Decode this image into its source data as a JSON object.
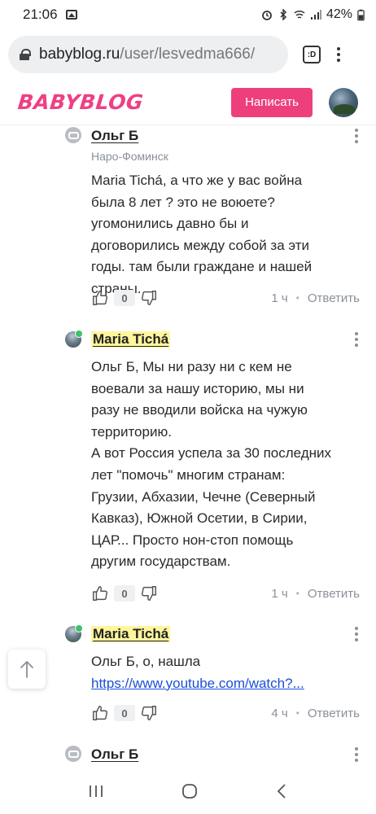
{
  "status_bar": {
    "time": "21:06",
    "battery": "42%"
  },
  "browser": {
    "url_host": "babyblog.ru",
    "url_path": "/user/lesvedma666/",
    "tabs_label": ":D"
  },
  "site": {
    "logo": "BABYBLOG",
    "write_button": "Написать"
  },
  "comments": [
    {
      "author": "Ольг Б",
      "city": "Наро-Фоминск",
      "paragraphs": [
        "Maria Tichá, а что же у вас война была 8 лет ? это не воюете? угомонились давно бы и договорились между собой за эти годы. там были граждане и нашей страны."
      ],
      "likes": "0",
      "time": "1 ч",
      "reply": "Ответить"
    },
    {
      "author": "Maria Tichá",
      "paragraphs": [
        "Ольг Б, Мы ни разу ни с кем не воевали за нашу историю, мы ни разу не вводили войска на чужую территорию.",
        "А вот Россия успела за 30 последних лет \"помочь\" многим странам: Грузии, Абхазии, Чечне (Северный Кавказ), Южной Осетии, в Сирии, ЦАР... Просто нон-стоп помощь другим государствам."
      ],
      "likes": "0",
      "time": "1 ч",
      "reply": "Ответить"
    },
    {
      "author": "Maria Tichá",
      "paragraphs": [
        "Ольг Б, о, нашла"
      ],
      "link": "https://www.youtube.com/watch?...",
      "likes": "0",
      "time": "4 ч",
      "reply": "Ответить"
    },
    {
      "author": "Ольг Б"
    }
  ],
  "icons": {
    "like": "thumbs-up-icon",
    "dislike": "thumbs-down-icon",
    "back_to_top": "arrow-up-icon",
    "nav_recents": "recents-icon",
    "nav_home": "home-icon",
    "nav_back": "back-icon"
  }
}
